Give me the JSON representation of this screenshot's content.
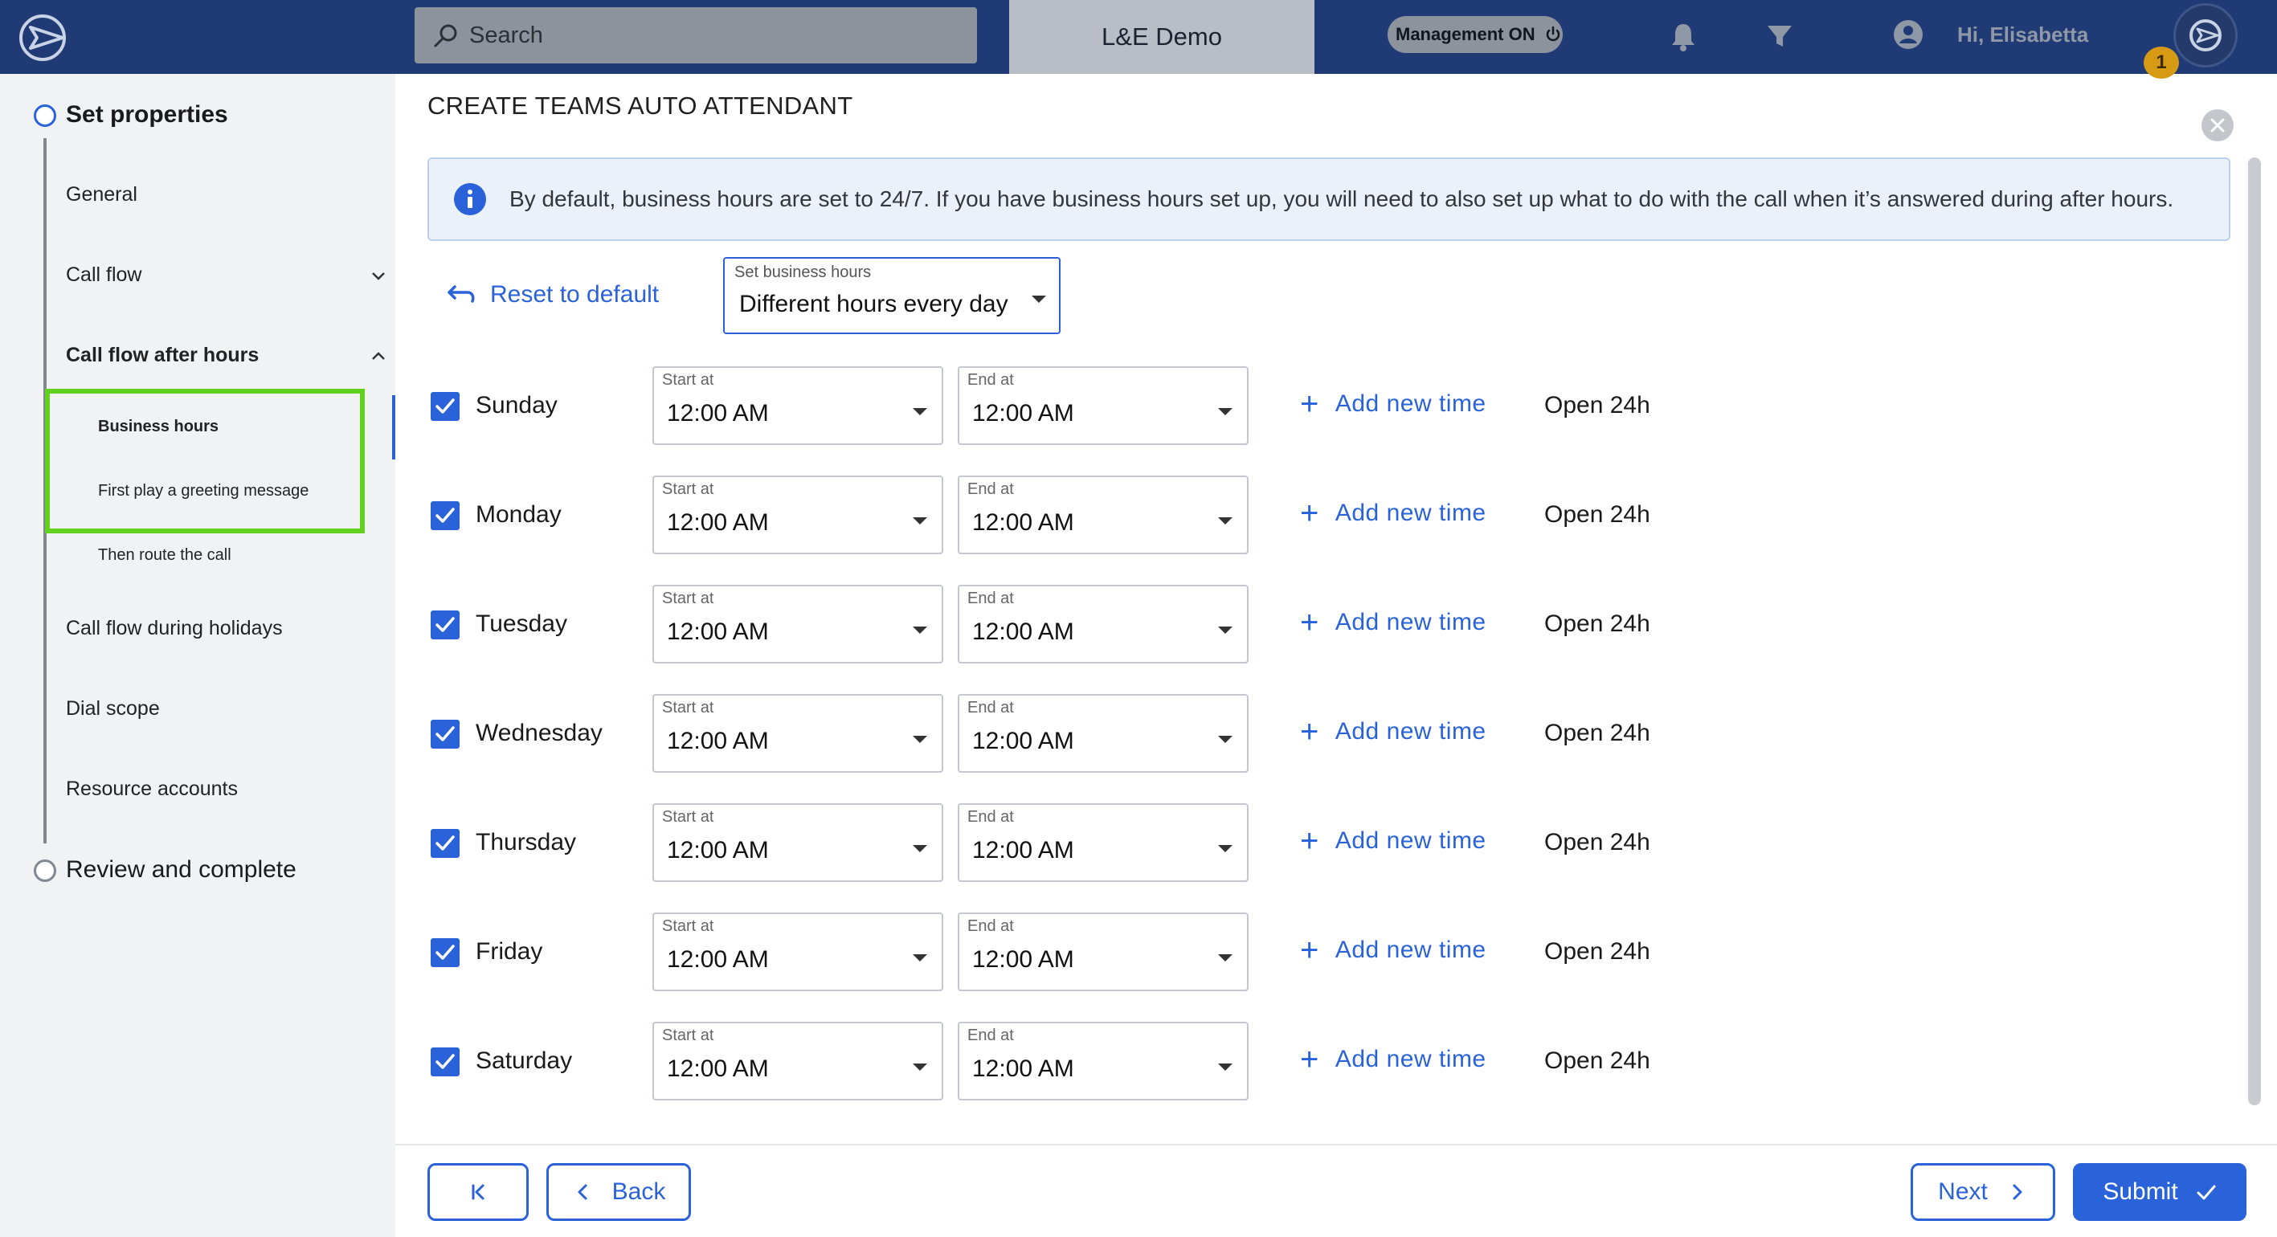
{
  "header": {
    "search_placeholder": "Search",
    "tenant_name": "L&E Demo",
    "management_label": "Management ON",
    "greeting": "Hi, Elisabetta",
    "notification_count": "1",
    "icons": [
      "app-logo-icon",
      "search-icon",
      "power-icon",
      "bell-icon",
      "filter-icon",
      "user-icon",
      "avatar-logo-icon"
    ]
  },
  "sidebar": {
    "steps": [
      {
        "label": "Set properties",
        "state": "active"
      },
      {
        "label": "Review and complete",
        "state": "pending"
      }
    ],
    "items": [
      {
        "label": "General"
      },
      {
        "label": "Call flow",
        "expandable": true,
        "expanded": false
      },
      {
        "label": "Call flow after hours",
        "expandable": true,
        "expanded": true,
        "bold": true
      }
    ],
    "sub_items": [
      {
        "label": "Business hours",
        "active": true
      },
      {
        "label": "First play a greeting message"
      },
      {
        "label": "Then route the call"
      }
    ],
    "items_after": [
      {
        "label": "Call flow during holidays"
      },
      {
        "label": "Dial scope"
      },
      {
        "label": "Resource accounts"
      }
    ]
  },
  "main": {
    "title": "CREATE TEAMS AUTO ATTENDANT",
    "info_message": "By default, business hours are set to 24/7. If you have business hours set up, you will need to also set up what to do with the call when it’s answered during after hours.",
    "reset_label": "Reset to default",
    "business_hours_select": {
      "label": "Set business hours",
      "value": "Different hours every day"
    },
    "start_label": "Start at",
    "end_label": "End at",
    "add_time_label": "Add new time",
    "days": [
      {
        "name": "Sunday",
        "checked": true,
        "start": "12:00 AM",
        "end": "12:00 AM",
        "status": "Open 24h"
      },
      {
        "name": "Monday",
        "checked": true,
        "start": "12:00 AM",
        "end": "12:00 AM",
        "status": "Open 24h"
      },
      {
        "name": "Tuesday",
        "checked": true,
        "start": "12:00 AM",
        "end": "12:00 AM",
        "status": "Open 24h"
      },
      {
        "name": "Wednesday",
        "checked": true,
        "start": "12:00 AM",
        "end": "12:00 AM",
        "status": "Open 24h"
      },
      {
        "name": "Thursday",
        "checked": true,
        "start": "12:00 AM",
        "end": "12:00 AM",
        "status": "Open 24h"
      },
      {
        "name": "Friday",
        "checked": true,
        "start": "12:00 AM",
        "end": "12:00 AM",
        "status": "Open 24h"
      },
      {
        "name": "Saturday",
        "checked": true,
        "start": "12:00 AM",
        "end": "12:00 AM",
        "status": "Open 24h"
      }
    ]
  },
  "footer": {
    "back_label": "Back",
    "next_label": "Next",
    "submit_label": "Submit"
  },
  "colors": {
    "header_bg": "#1f3a74",
    "accent": "#2962d9",
    "highlight_outline": "#62d01f",
    "sidebar_bg": "#f1f2f4",
    "badge": "#d69a14"
  }
}
